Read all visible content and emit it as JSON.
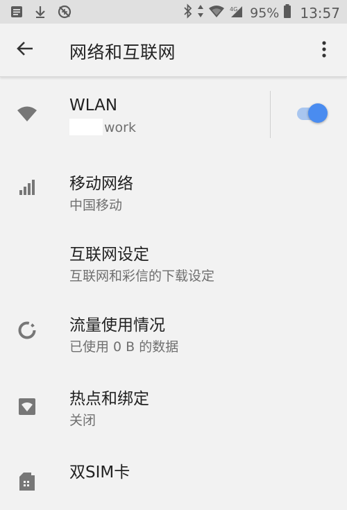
{
  "status_bar": {
    "battery_percent": "95%",
    "time": "13:57"
  },
  "app_bar": {
    "title": "网络和互联网"
  },
  "items": [
    {
      "title": "WLAN",
      "summary": "work",
      "icon": "wifi-icon",
      "toggle_on": true
    },
    {
      "title": "移动网络",
      "summary": "中国移动",
      "icon": "signal-icon"
    },
    {
      "title": "互联网设定",
      "summary": "互联网和彩信的下载设定"
    },
    {
      "title": "流量使用情况",
      "summary": "已使用 0 B 的数据",
      "icon": "data-usage-icon"
    },
    {
      "title": "热点和绑定",
      "summary": "关闭",
      "icon": "hotspot-icon"
    },
    {
      "title": "双SIM卡",
      "icon": "sim-card-icon"
    }
  ],
  "colors": {
    "accent": "#4a8cf0",
    "toggle_track": "#a9c6ef",
    "background": "#f2f2f2",
    "status_bar": "#e0e0e0"
  }
}
